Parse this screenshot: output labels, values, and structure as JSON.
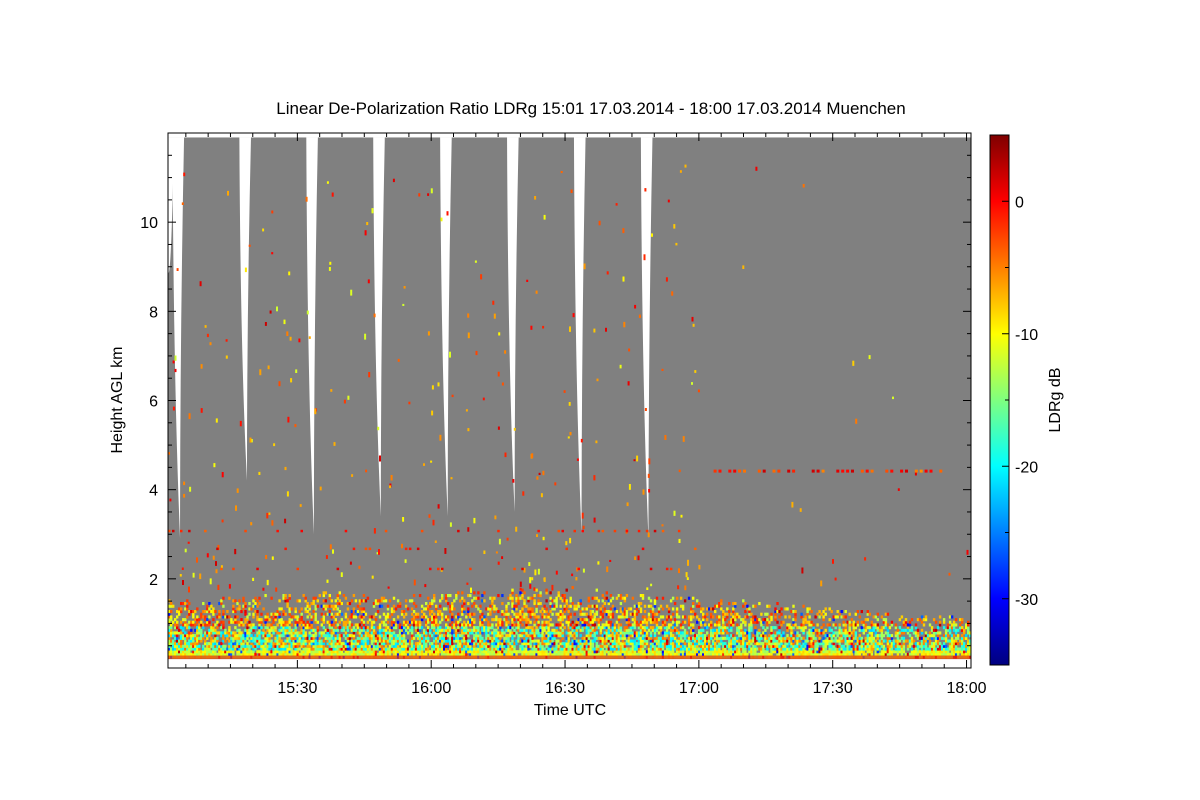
{
  "chart_data": {
    "type": "heatmap",
    "title": "Linear De-Polarization Ratio LDRg   15:01 17.03.2014 - 18:00 17.03.2014 Muenchen",
    "xlabel": "Time UTC",
    "ylabel": "Height AGL km",
    "colorbar_label": "LDRg dB",
    "x_range_min": [
      901,
      1081
    ],
    "x_ticks": [
      {
        "value": 930,
        "label": "15:30"
      },
      {
        "value": 960,
        "label": "16:00"
      },
      {
        "value": 990,
        "label": "16:30"
      },
      {
        "value": 1020,
        "label": "17:00"
      },
      {
        "value": 1050,
        "label": "17:30"
      },
      {
        "value": 1080,
        "label": "18:00"
      }
    ],
    "ylim": [
      0,
      12
    ],
    "y_ticks": [
      {
        "value": 2,
        "label": "2"
      },
      {
        "value": 4,
        "label": "4"
      },
      {
        "value": 6,
        "label": "6"
      },
      {
        "value": 8,
        "label": "8"
      },
      {
        "value": 10,
        "label": "10"
      }
    ],
    "colorbar_range": [
      -35,
      5
    ],
    "colorbar_ticks": [
      {
        "value": 0,
        "label": "0"
      },
      {
        "value": -10,
        "label": "-10"
      },
      {
        "value": -20,
        "label": "-20"
      },
      {
        "value": -30,
        "label": "-30"
      }
    ],
    "colormap": "jet",
    "no_signal_color": "#808080",
    "scan_gaps_start_min": [
      902,
      917,
      932,
      947,
      962,
      977,
      992,
      1007
    ],
    "scan_gap_bottom_km": [
      8.9,
      2.9,
      4.2,
      3.0,
      3.4,
      3.4,
      3.5,
      3.0,
      2.9
    ],
    "boundary_layer_top_km": [
      1.5,
      1.6,
      1.7,
      1.6,
      1.7,
      1.8,
      1.6,
      1.5,
      1.4,
      1.2,
      1.1
    ]
  }
}
